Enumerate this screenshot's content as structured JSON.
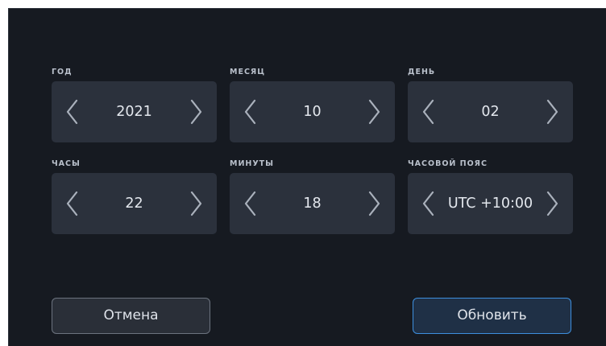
{
  "fields": {
    "year": {
      "label": "ГОД",
      "value": "2021"
    },
    "month": {
      "label": "МЕСЯЦ",
      "value": "10"
    },
    "day": {
      "label": "ДЕНЬ",
      "value": "02"
    },
    "hours": {
      "label": "ЧАСЫ",
      "value": "22"
    },
    "minutes": {
      "label": "МИНУТЫ",
      "value": "18"
    },
    "timezone": {
      "label": "ЧАСОВОЙ ПОЯС",
      "value": "UTC +10:00"
    }
  },
  "buttons": {
    "cancel_label": "Отмена",
    "update_label": "Обновить"
  },
  "icons": {
    "decrement": "chevron-left-icon",
    "increment": "chevron-right-icon"
  },
  "colors": {
    "panel_background": "#161a21",
    "stepper_background": "#2b313c",
    "accent_border": "#3d8fde",
    "text": "#e4e8ee"
  }
}
